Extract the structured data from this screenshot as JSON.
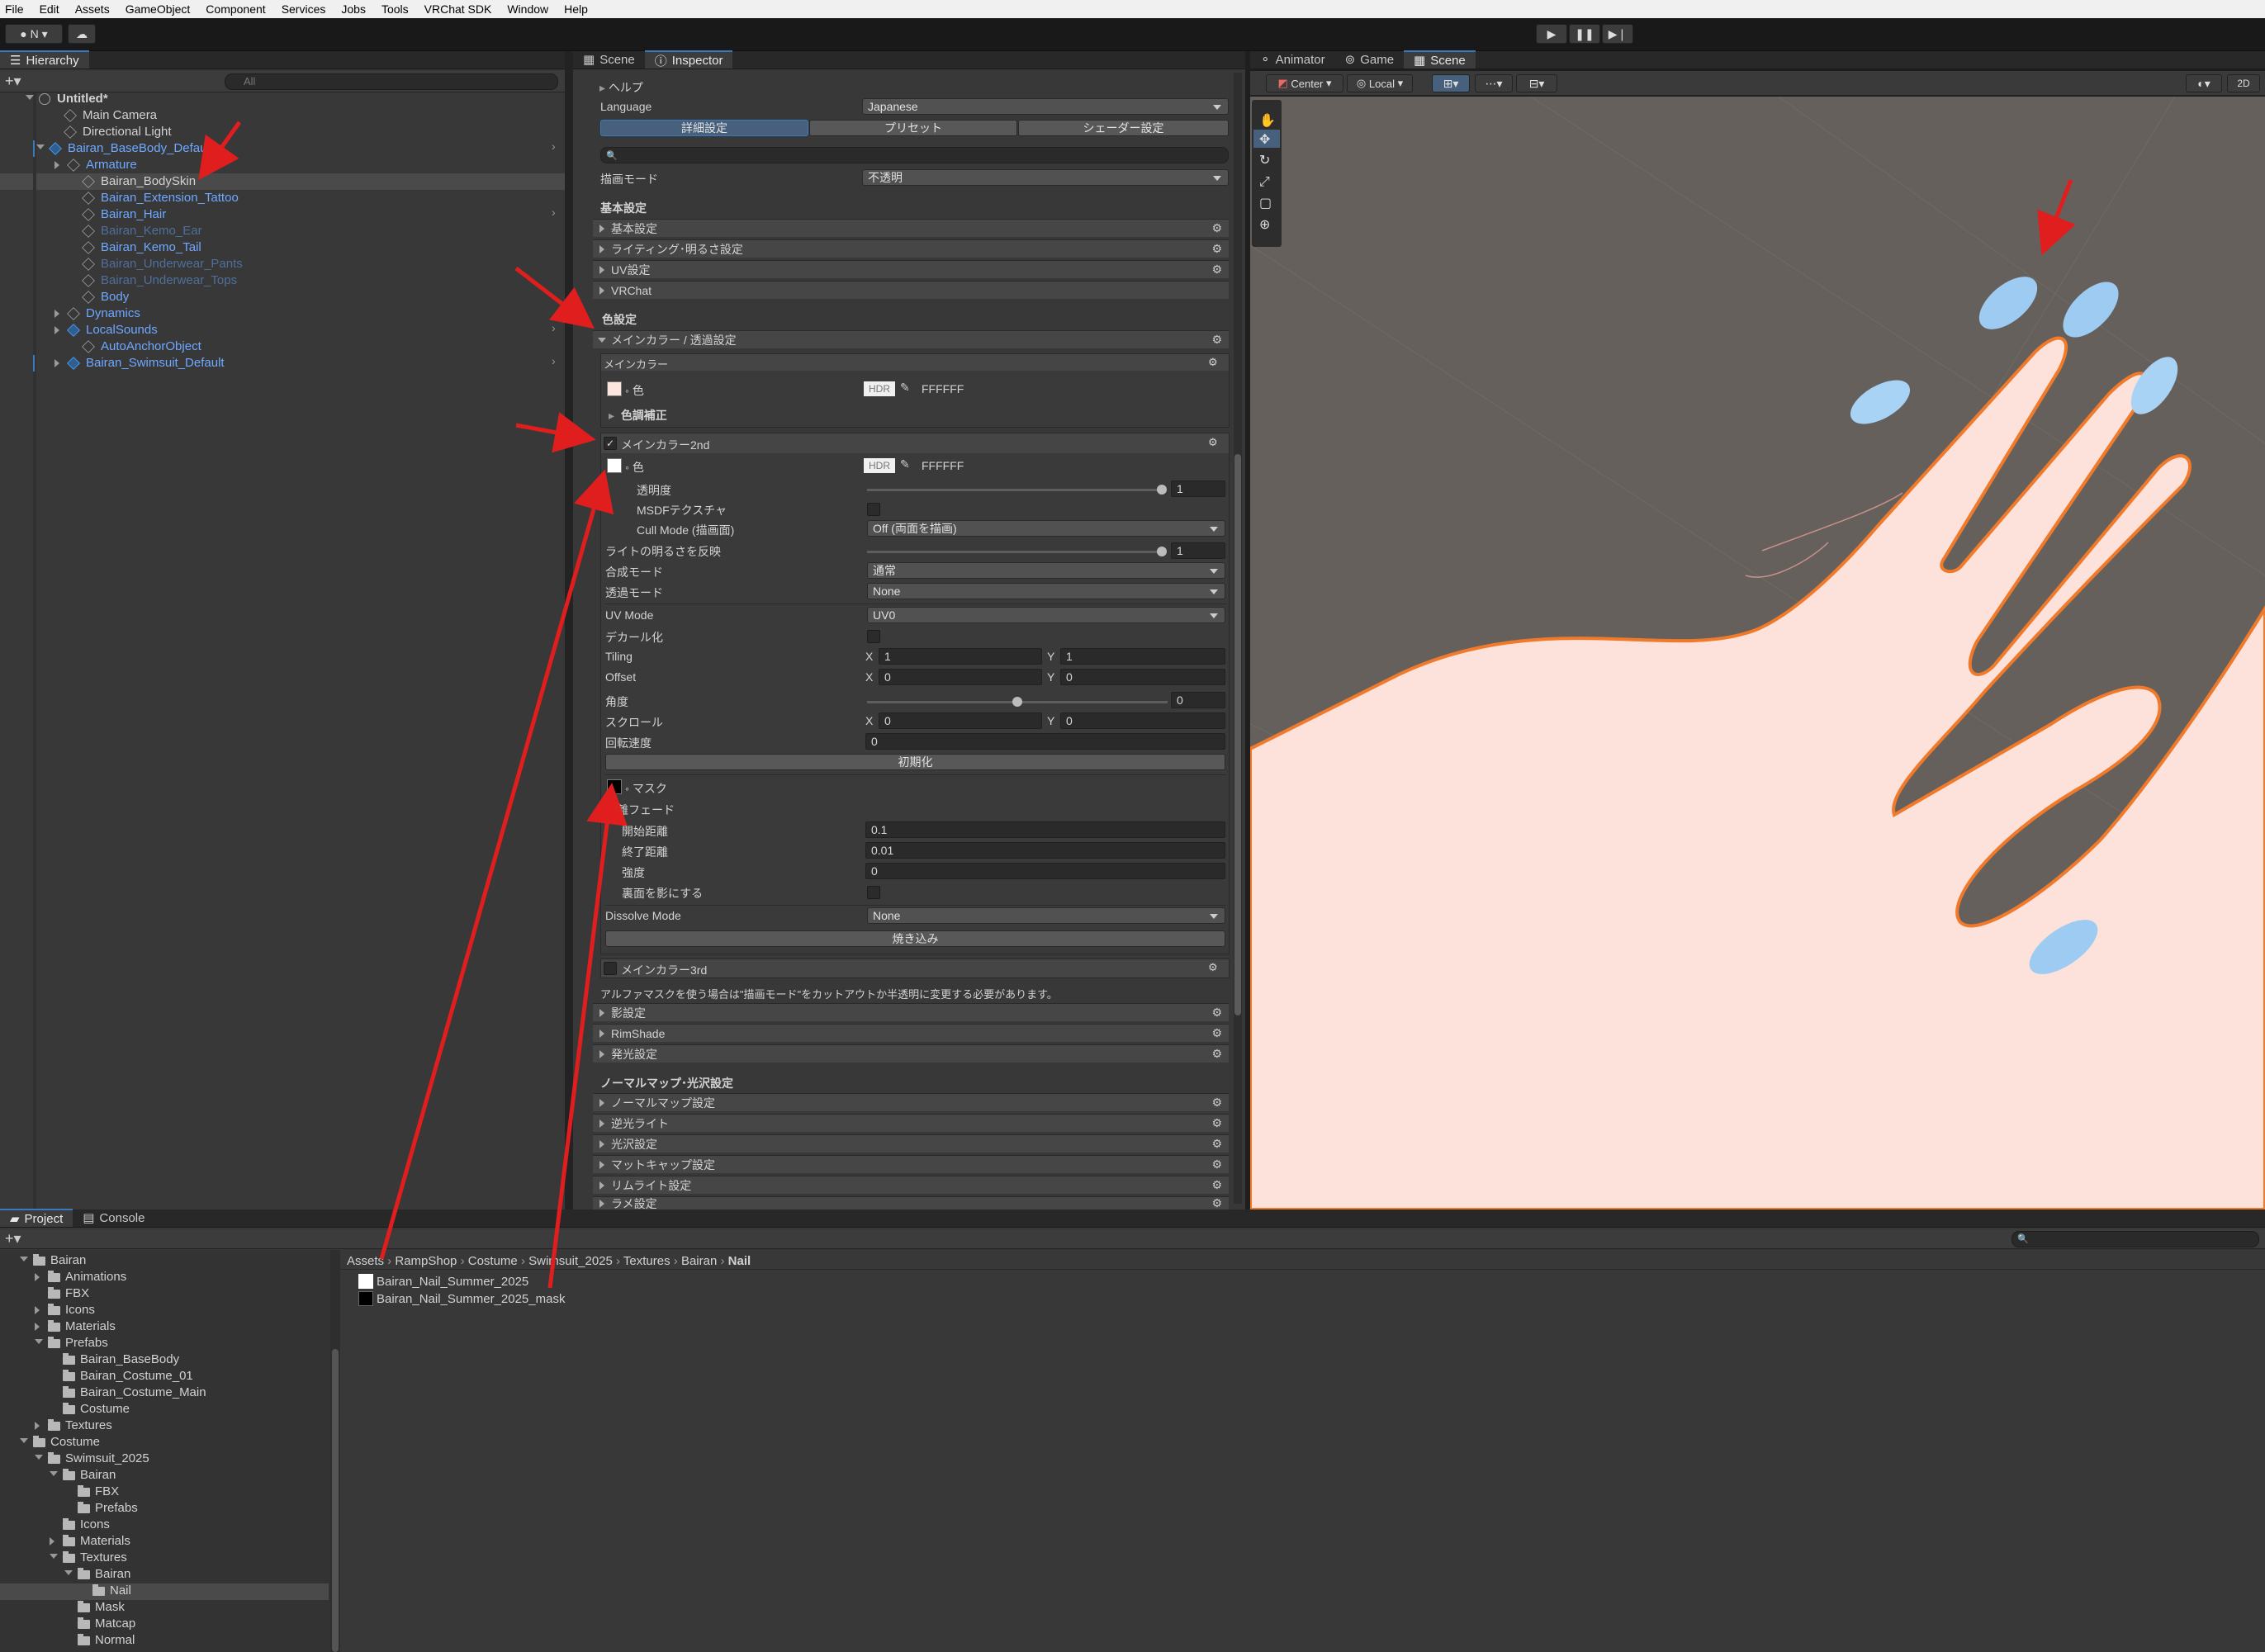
{
  "menu": [
    "File",
    "Edit",
    "Assets",
    "GameObject",
    "Component",
    "Services",
    "Jobs",
    "Tools",
    "VRChat SDK",
    "Window",
    "Help"
  ],
  "toolbar": {
    "account": "N",
    "play_icon": "play-icon",
    "pause_icon": "pause-icon",
    "step_icon": "step-icon"
  },
  "hierarchy": {
    "tab": "Hierarchy",
    "search_placeholder": "All",
    "items": [
      {
        "label": "Untitled*"
      },
      {
        "label": "Main Camera"
      },
      {
        "label": "Directional Light"
      },
      {
        "label": "Bairan_BaseBody_Default"
      },
      {
        "label": "Armature"
      },
      {
        "label": "Bairan_BodySkin"
      },
      {
        "label": "Bairan_Extension_Tattoo"
      },
      {
        "label": "Bairan_Hair"
      },
      {
        "label": "Bairan_Kemo_Ear"
      },
      {
        "label": "Bairan_Kemo_Tail"
      },
      {
        "label": "Bairan_Underwear_Pants"
      },
      {
        "label": "Bairan_Underwear_Tops"
      },
      {
        "label": "Body"
      },
      {
        "label": "Dynamics"
      },
      {
        "label": "LocalSounds"
      },
      {
        "label": "AutoAnchorObject"
      },
      {
        "label": "Bairan_Swimsuit_Default"
      }
    ]
  },
  "inspector": {
    "tabs": [
      "Scene",
      "Inspector"
    ],
    "help": "ヘルプ",
    "language_label": "Language",
    "language_value": "Japanese",
    "mode_tabs": [
      "詳細設定",
      "プリセット",
      "シェーダー設定"
    ],
    "render_mode_label": "描画モード",
    "render_mode_value": "不透明",
    "basic_header": "基本設定",
    "basic_sections": [
      "基本設定",
      "ライティング･明るさ設定",
      "UV設定",
      "VRChat"
    ],
    "color_header": "色設定",
    "main_color_section": "メインカラー / 透過設定",
    "main_color_sub": "メインカラー",
    "color_label": "色",
    "hdr": "HDR",
    "hex1": "FFFFFF",
    "tone": "色調補正",
    "main2": "メインカラー2nd",
    "hex2": "FFFFFF",
    "opacity_label": "透明度",
    "opacity_value": "1",
    "msdf": "MSDFテクスチャ",
    "cull_label": "Cull Mode (描画面)",
    "cull_value": "Off (両面を描画)",
    "light_reflect": "ライトの明るさを反映",
    "light_value": "1",
    "blend_label": "合成モード",
    "blend_value": "通常",
    "alpha_label": "透過モード",
    "alpha_value": "None",
    "uv_label": "UV Mode",
    "uv_value": "UV0",
    "decal": "デカール化",
    "tiling": "Tiling",
    "tiling_x": "1",
    "tiling_y": "1",
    "offset": "Offset",
    "offset_x": "0",
    "offset_y": "0",
    "angle": "角度",
    "angle_value": "0",
    "scroll": "スクロール",
    "scroll_x": "0",
    "scroll_y": "0",
    "rot_speed": "回転速度",
    "rot_value": "0",
    "reset": "初期化",
    "mask": "マスク",
    "dist_fade": "距離フェード",
    "start_dist": "開始距離",
    "start_value": "0.1",
    "end_dist": "終了距離",
    "end_value": "0.01",
    "strength": "強度",
    "strength_value": "0",
    "backface": "裏面を影にする",
    "dissolve_label": "Dissolve Mode",
    "dissolve_value": "None",
    "bake": "焼き込み",
    "main3": "メインカラー3rd",
    "note": "アルファマスクを使う場合は\"描画モード\"をカットアウトか半透明に変更する必要があります。",
    "other_sections": [
      "影設定",
      "RimShade",
      "発光設定"
    ],
    "normal_header": "ノーマルマップ･光沢設定",
    "normal_sections": [
      "ノーマルマップ設定",
      "逆光ライト",
      "光沢設定",
      "マットキャップ設定",
      "リムライト設定",
      "ラメ設定"
    ],
    "xy": [
      "X",
      "Y"
    ]
  },
  "scene": {
    "tabs": [
      "Animator",
      "Game",
      "Scene"
    ],
    "pivot": "Center",
    "space": "Local",
    "mode2d": "2D"
  },
  "project": {
    "tabs": [
      "Project",
      "Console"
    ],
    "breadcrumb": [
      "Assets",
      "RampShop",
      "Costume",
      "Swimsuit_2025",
      "Textures",
      "Bairan",
      "Nail"
    ],
    "files": [
      "Bairan_Nail_Summer_2025",
      "Bairan_Nail_Summer_2025_mask"
    ],
    "tree": [
      {
        "label": "Bairan",
        "d": 1,
        "t": "open"
      },
      {
        "label": "Animations",
        "d": 2,
        "t": "closed"
      },
      {
        "label": "FBX",
        "d": 2,
        "t": "none"
      },
      {
        "label": "Icons",
        "d": 2,
        "t": "closed"
      },
      {
        "label": "Materials",
        "d": 2,
        "t": "closed"
      },
      {
        "label": "Prefabs",
        "d": 2,
        "t": "open"
      },
      {
        "label": "Bairan_BaseBody",
        "d": 3,
        "t": "none"
      },
      {
        "label": "Bairan_Costume_01",
        "d": 3,
        "t": "none"
      },
      {
        "label": "Bairan_Costume_Main",
        "d": 3,
        "t": "none"
      },
      {
        "label": "Costume",
        "d": 3,
        "t": "none"
      },
      {
        "label": "Textures",
        "d": 2,
        "t": "closed"
      },
      {
        "label": "Costume",
        "d": 1,
        "t": "open"
      },
      {
        "label": "Swimsuit_2025",
        "d": 2,
        "t": "open"
      },
      {
        "label": "Bairan",
        "d": 3,
        "t": "open"
      },
      {
        "label": "FBX",
        "d": 4,
        "t": "none"
      },
      {
        "label": "Prefabs",
        "d": 4,
        "t": "none"
      },
      {
        "label": "Icons",
        "d": 3,
        "t": "none"
      },
      {
        "label": "Materials",
        "d": 3,
        "t": "closed"
      },
      {
        "label": "Textures",
        "d": 3,
        "t": "open"
      },
      {
        "label": "Bairan",
        "d": 4,
        "t": "open"
      },
      {
        "label": "Nail",
        "d": 5,
        "t": "none"
      },
      {
        "label": "Mask",
        "d": 4,
        "t": "none"
      },
      {
        "label": "Matcap",
        "d": 4,
        "t": "none"
      },
      {
        "label": "Normal",
        "d": 4,
        "t": "none"
      }
    ]
  },
  "colors": {
    "accent": "#3a79bb",
    "annotation": "#e01e1e",
    "skin": "#fde0da",
    "nail": "#a9d3f5",
    "outline": "#f07a2a"
  }
}
